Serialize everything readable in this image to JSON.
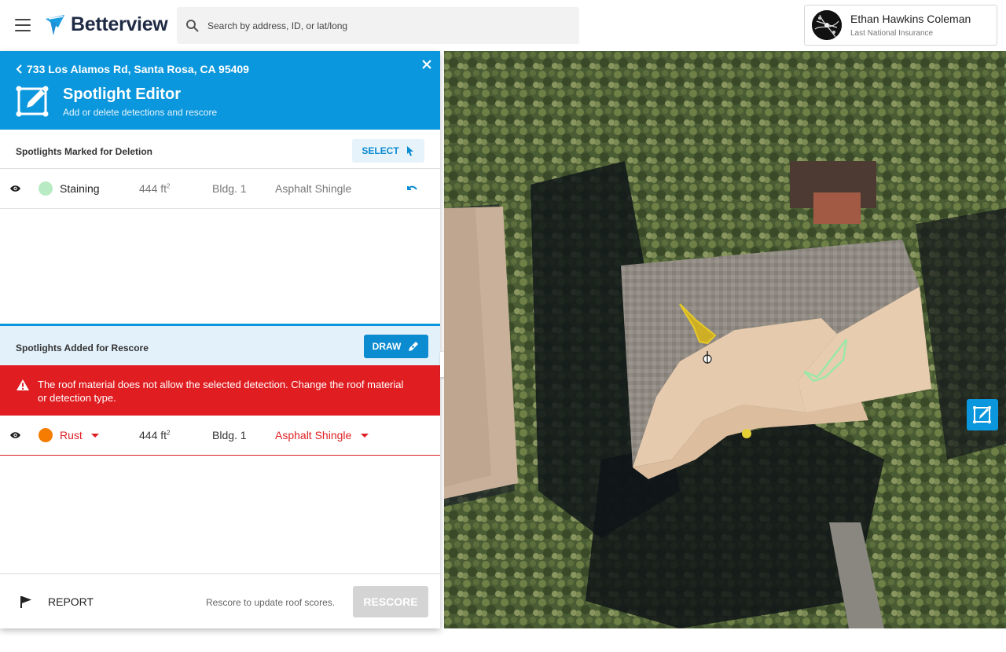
{
  "app": {
    "brand": "Betterview",
    "search_placeholder": "Search by address, ID, or lat/long"
  },
  "user": {
    "name": "Ethan Hawkins Coleman",
    "organization": "Last National Insurance"
  },
  "editor": {
    "address": "733 Los Alamos Rd, Santa Rosa, CA 95409",
    "title": "Spotlight Editor",
    "subtitle": "Add or delete detections and rescore"
  },
  "deletion": {
    "title": "Spotlights Marked for Deletion",
    "select_label": "SELECT",
    "items": [
      {
        "name": "Staining",
        "color": "#b8ebc4",
        "area": "444 ft",
        "area_unit_sup": "2",
        "building": "Bldg. 1",
        "material": "Asphalt Shingle"
      }
    ]
  },
  "rescore": {
    "title": "Spotlights Added for Rescore",
    "draw_label": "DRAW",
    "error": "The roof material does not allow the selected detection. Change the roof material or detection type.",
    "items": [
      {
        "name": "Rust",
        "color": "#f57c00",
        "area": "444 ft",
        "area_unit_sup": "2",
        "building": "Bldg. 1",
        "material": "Asphalt Shingle"
      }
    ]
  },
  "footer": {
    "report_label": "REPORT",
    "hint": "Rescore to update roof scores.",
    "rescore_label": "RESCORE"
  },
  "colors": {
    "accent": "#0b97dd",
    "error": "#e01e22",
    "detection_yellow": "#e3c51c",
    "detection_green": "#9be8a6"
  }
}
